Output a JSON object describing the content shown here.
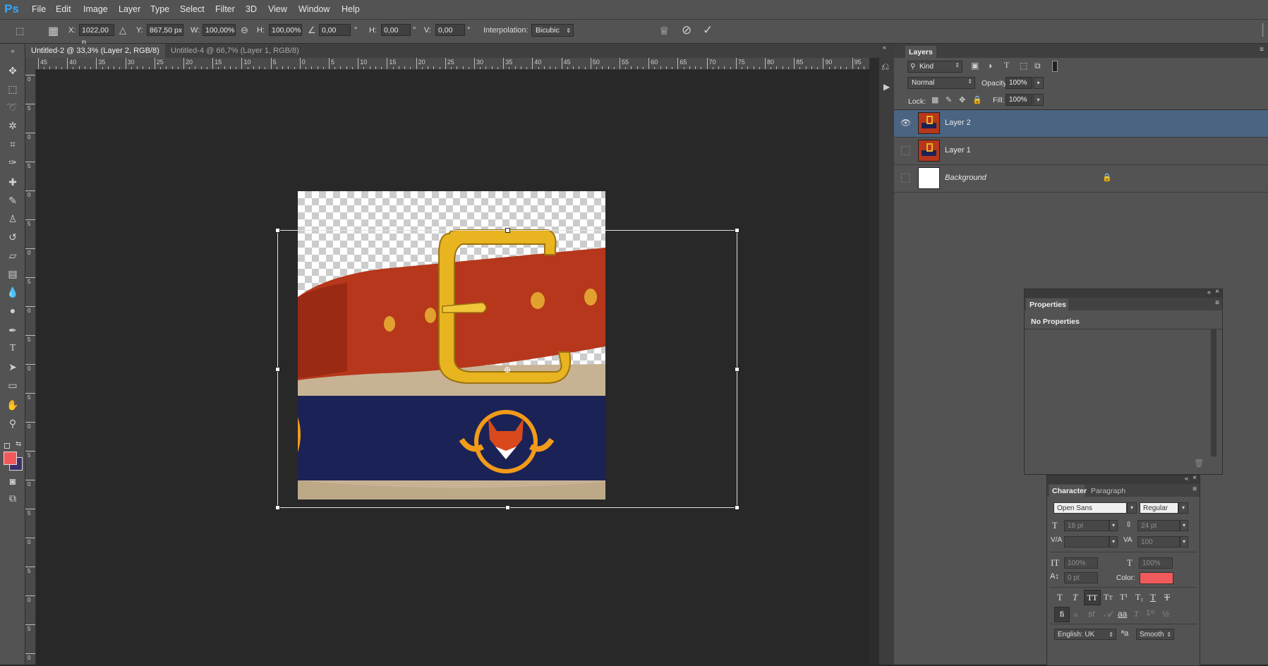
{
  "app": {
    "logo": "Ps"
  },
  "menu": [
    "File",
    "Edit",
    "Image",
    "Layer",
    "Type",
    "Select",
    "Filter",
    "3D",
    "View",
    "Window",
    "Help"
  ],
  "options": {
    "x_label": "X:",
    "x_value": "1022,00 p",
    "y_label": "Y:",
    "y_value": "867,50 px",
    "w_label": "W:",
    "w_value": "100,00%",
    "h_label": "H:",
    "h_value": "100,00%",
    "angle_value": "0,00",
    "angle_unit": "°",
    "hskew_label": "H:",
    "hskew_value": "0,00",
    "hskew_unit": "°",
    "vskew_label": "V:",
    "vskew_value": "0,00",
    "vskew_unit": "°",
    "interp_label": "Interpolation:",
    "interp_value": "Bicubic"
  },
  "tabs": [
    {
      "label": "Untitled-2 @ 33,3% (Layer 2, RGB/8) *",
      "active": true
    },
    {
      "label": "Untitled-4 @ 66,7% (Layer 1, RGB/8) *",
      "active": false
    }
  ],
  "ruler_h": [
    "45",
    "40",
    "35",
    "30",
    "25",
    "20",
    "15",
    "10",
    "5",
    "0",
    "5",
    "10",
    "15",
    "20",
    "25",
    "30",
    "35",
    "40",
    "45",
    "50",
    "55",
    "60",
    "65",
    "70",
    "75",
    "80",
    "85",
    "90",
    "95"
  ],
  "ruler_v": [
    "0",
    "5",
    "0",
    "5",
    "0",
    "5",
    "0",
    "5",
    "0",
    "5",
    "0",
    "5",
    "0",
    "5",
    "0",
    "5",
    "0",
    "5",
    "0",
    "5",
    "0"
  ],
  "layers_panel": {
    "tab": "Layers",
    "kind_label": "Kind",
    "blend_mode": "Normal",
    "opacity_label": "Opacity:",
    "opacity_value": "100%",
    "lock_label": "Lock:",
    "fill_label": "Fill:",
    "fill_value": "100%",
    "layers": [
      {
        "name": "Layer 2",
        "selected": true,
        "visible": true
      },
      {
        "name": "Layer 1",
        "selected": false,
        "visible": false
      },
      {
        "name": "Background",
        "selected": false,
        "visible": false,
        "locked": true
      }
    ]
  },
  "properties_panel": {
    "tab": "Properties",
    "message": "No Properties"
  },
  "character_panel": {
    "tab_character": "Character",
    "tab_paragraph": "Paragraph",
    "font_family": "Open Sans",
    "font_style": "Regular",
    "font_size": "18 pt",
    "leading": "24 pt",
    "kerning": "",
    "tracking": "100",
    "vertical_scale": "100%",
    "horizontal_scale": "100%",
    "baseline_shift": "0 pt",
    "color_label": "Color:",
    "language": "English: UK",
    "antialias": "Smooth"
  },
  "colors": {
    "foreground": "#f15a5a",
    "background": "#3a2e6a",
    "accent": "#4a6482"
  }
}
